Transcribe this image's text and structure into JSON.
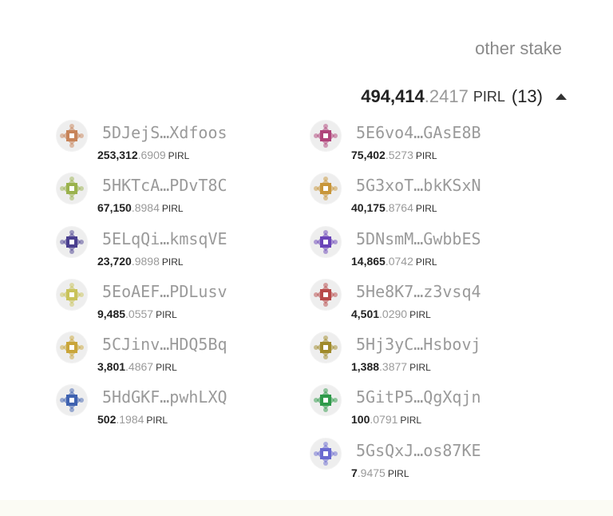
{
  "header": {
    "column_title": "other stake"
  },
  "total": {
    "integer": "494,414",
    "decimal": ".2417",
    "unit": "PIRL",
    "count": "(13)"
  },
  "nominators": [
    {
      "address": "5DJejS…Xdfoos",
      "int": "253,312",
      "dec": ".6909",
      "unit": "PIRL",
      "color": "#c7845a"
    },
    {
      "address": "5HKTcA…PDvT8C",
      "int": "67,150",
      "dec": ".8984",
      "unit": "PIRL",
      "color": "#9ab24d"
    },
    {
      "address": "5ELqQi…kmsqVE",
      "int": "23,720",
      "dec": ".9898",
      "unit": "PIRL",
      "color": "#4a3f8f"
    },
    {
      "address": "5EoAEF…PDLusv",
      "int": "9,485",
      "dec": ".0557",
      "unit": "PIRL",
      "color": "#c9c35a"
    },
    {
      "address": "5CJinv…HDQ5Bq",
      "int": "3,801",
      "dec": ".4867",
      "unit": "PIRL",
      "color": "#c9a53a"
    },
    {
      "address": "5HdGKF…pwhLXQ",
      "int": "502",
      "dec": ".1984",
      "unit": "PIRL",
      "color": "#3f62b0"
    },
    {
      "address": "5E6vo4…GAsE8B",
      "int": "75,402",
      "dec": ".5273",
      "unit": "PIRL",
      "color": "#b0447a"
    },
    {
      "address": "5G3xoT…bkKSxN",
      "int": "40,175",
      "dec": ".8764",
      "unit": "PIRL",
      "color": "#c8963a"
    },
    {
      "address": "5DNsmM…GwbbES",
      "int": "14,865",
      "dec": ".0742",
      "unit": "PIRL",
      "color": "#6a44b8"
    },
    {
      "address": "5He8K7…z3vsq4",
      "int": "4,501",
      "dec": ".0290",
      "unit": "PIRL",
      "color": "#b84a4a"
    },
    {
      "address": "5Hj3yC…Hsbovj",
      "int": "1,388",
      "dec": ".3877",
      "unit": "PIRL",
      "color": "#a08a2a"
    },
    {
      "address": "5GitP5…QgXqjn",
      "int": "100",
      "dec": ".0791",
      "unit": "PIRL",
      "color": "#2f9a4a"
    },
    {
      "address": "5GsQxJ…os87KE",
      "int": "7",
      "dec": ".9475",
      "unit": "PIRL",
      "color": "#6a6ad0"
    }
  ]
}
